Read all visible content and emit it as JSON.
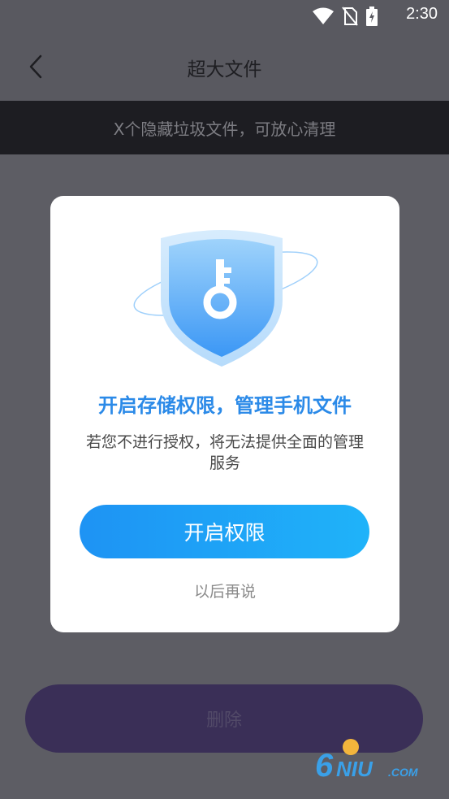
{
  "status": {
    "time": "2:30"
  },
  "appbar": {
    "title": "超大文件"
  },
  "notice": {
    "text": "X个隐藏垃圾文件，可放心清理"
  },
  "actions": {
    "delete_label": "删除"
  },
  "dialog": {
    "title": "开启存储权限，管理手机文件",
    "description": "若您不进行授权，将无法提供全面的管理服务",
    "confirm_label": "开启权限",
    "later_label": "以后再说"
  },
  "colors": {
    "accent": "#2b8ae8",
    "button_start": "#1e93f4",
    "button_end": "#1fb3f9",
    "overlay": "#5d5d64",
    "delete_bg": "#3a2f57"
  },
  "icons": [
    "wifi-icon",
    "no-sim-icon",
    "battery-charging-icon",
    "back-arrow-icon",
    "shield-key-icon"
  ]
}
